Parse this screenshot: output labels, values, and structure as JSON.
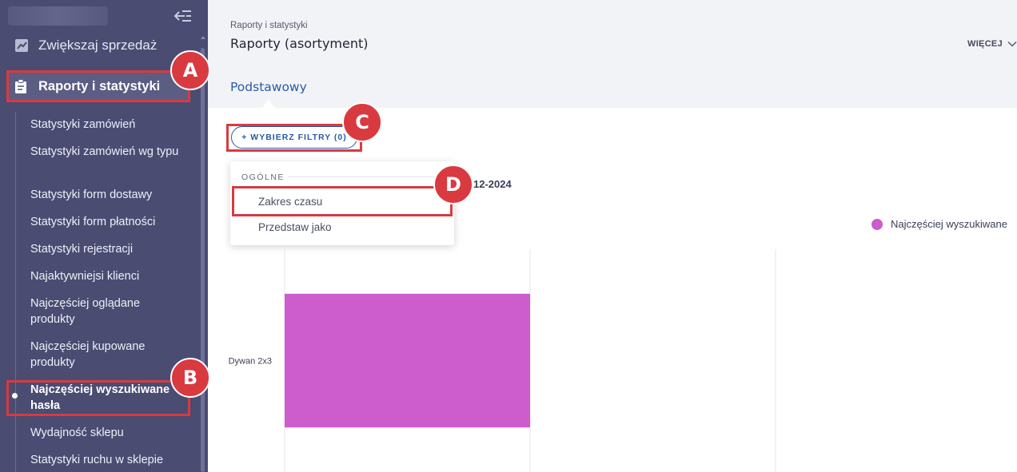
{
  "sidebar": {
    "sell_label": "Zwiększaj sprzedaż",
    "reports_label": "Raporty i statystyki",
    "items": [
      {
        "label": "Statystyki zamówień"
      },
      {
        "label": "Statystyki zamówień wg typu"
      },
      {
        "label": "Statystyki form dostawy"
      },
      {
        "label": "Statystyki form płatności"
      },
      {
        "label": "Statystyki rejestracji"
      },
      {
        "label": "Najaktywniejsi klienci"
      },
      {
        "label": "Najczęściej oglądane produkty"
      },
      {
        "label": "Najczęściej kupowane produkty"
      },
      {
        "label": "Najczęściej wyszukiwane hasła"
      },
      {
        "label": "Wydajność sklepu"
      },
      {
        "label": "Statystyki ruchu w sklepie"
      }
    ]
  },
  "header": {
    "breadcrumb": "Raporty i statystyki",
    "title": "Raporty (asortyment)",
    "more_label": "WIĘCEJ",
    "tab_label": "Podstawowy"
  },
  "filters": {
    "button_label": "+ WYBIERZ FILTRY (0)",
    "dropdown_header": "OGÓLNE",
    "options": [
      "Zakres czasu",
      "Przedstaw jako"
    ]
  },
  "date_fragment": "12-2024",
  "annotations": {
    "a": "A",
    "b": "B",
    "c": "C",
    "d": "D"
  },
  "colors": {
    "accent": "#2a5aa8",
    "sidebar_bg": "#4a4c72",
    "bar": "#cd5ccd",
    "highlight": "#d83a40"
  },
  "chart_data": {
    "type": "bar",
    "orientation": "horizontal",
    "categories": [
      "Dywan 2x3"
    ],
    "series": [
      {
        "name": "Najczęściej wyszukiwane",
        "values": [
          1
        ]
      }
    ],
    "xlim": [
      0,
      2
    ],
    "grid": true,
    "legend": "top-right"
  }
}
